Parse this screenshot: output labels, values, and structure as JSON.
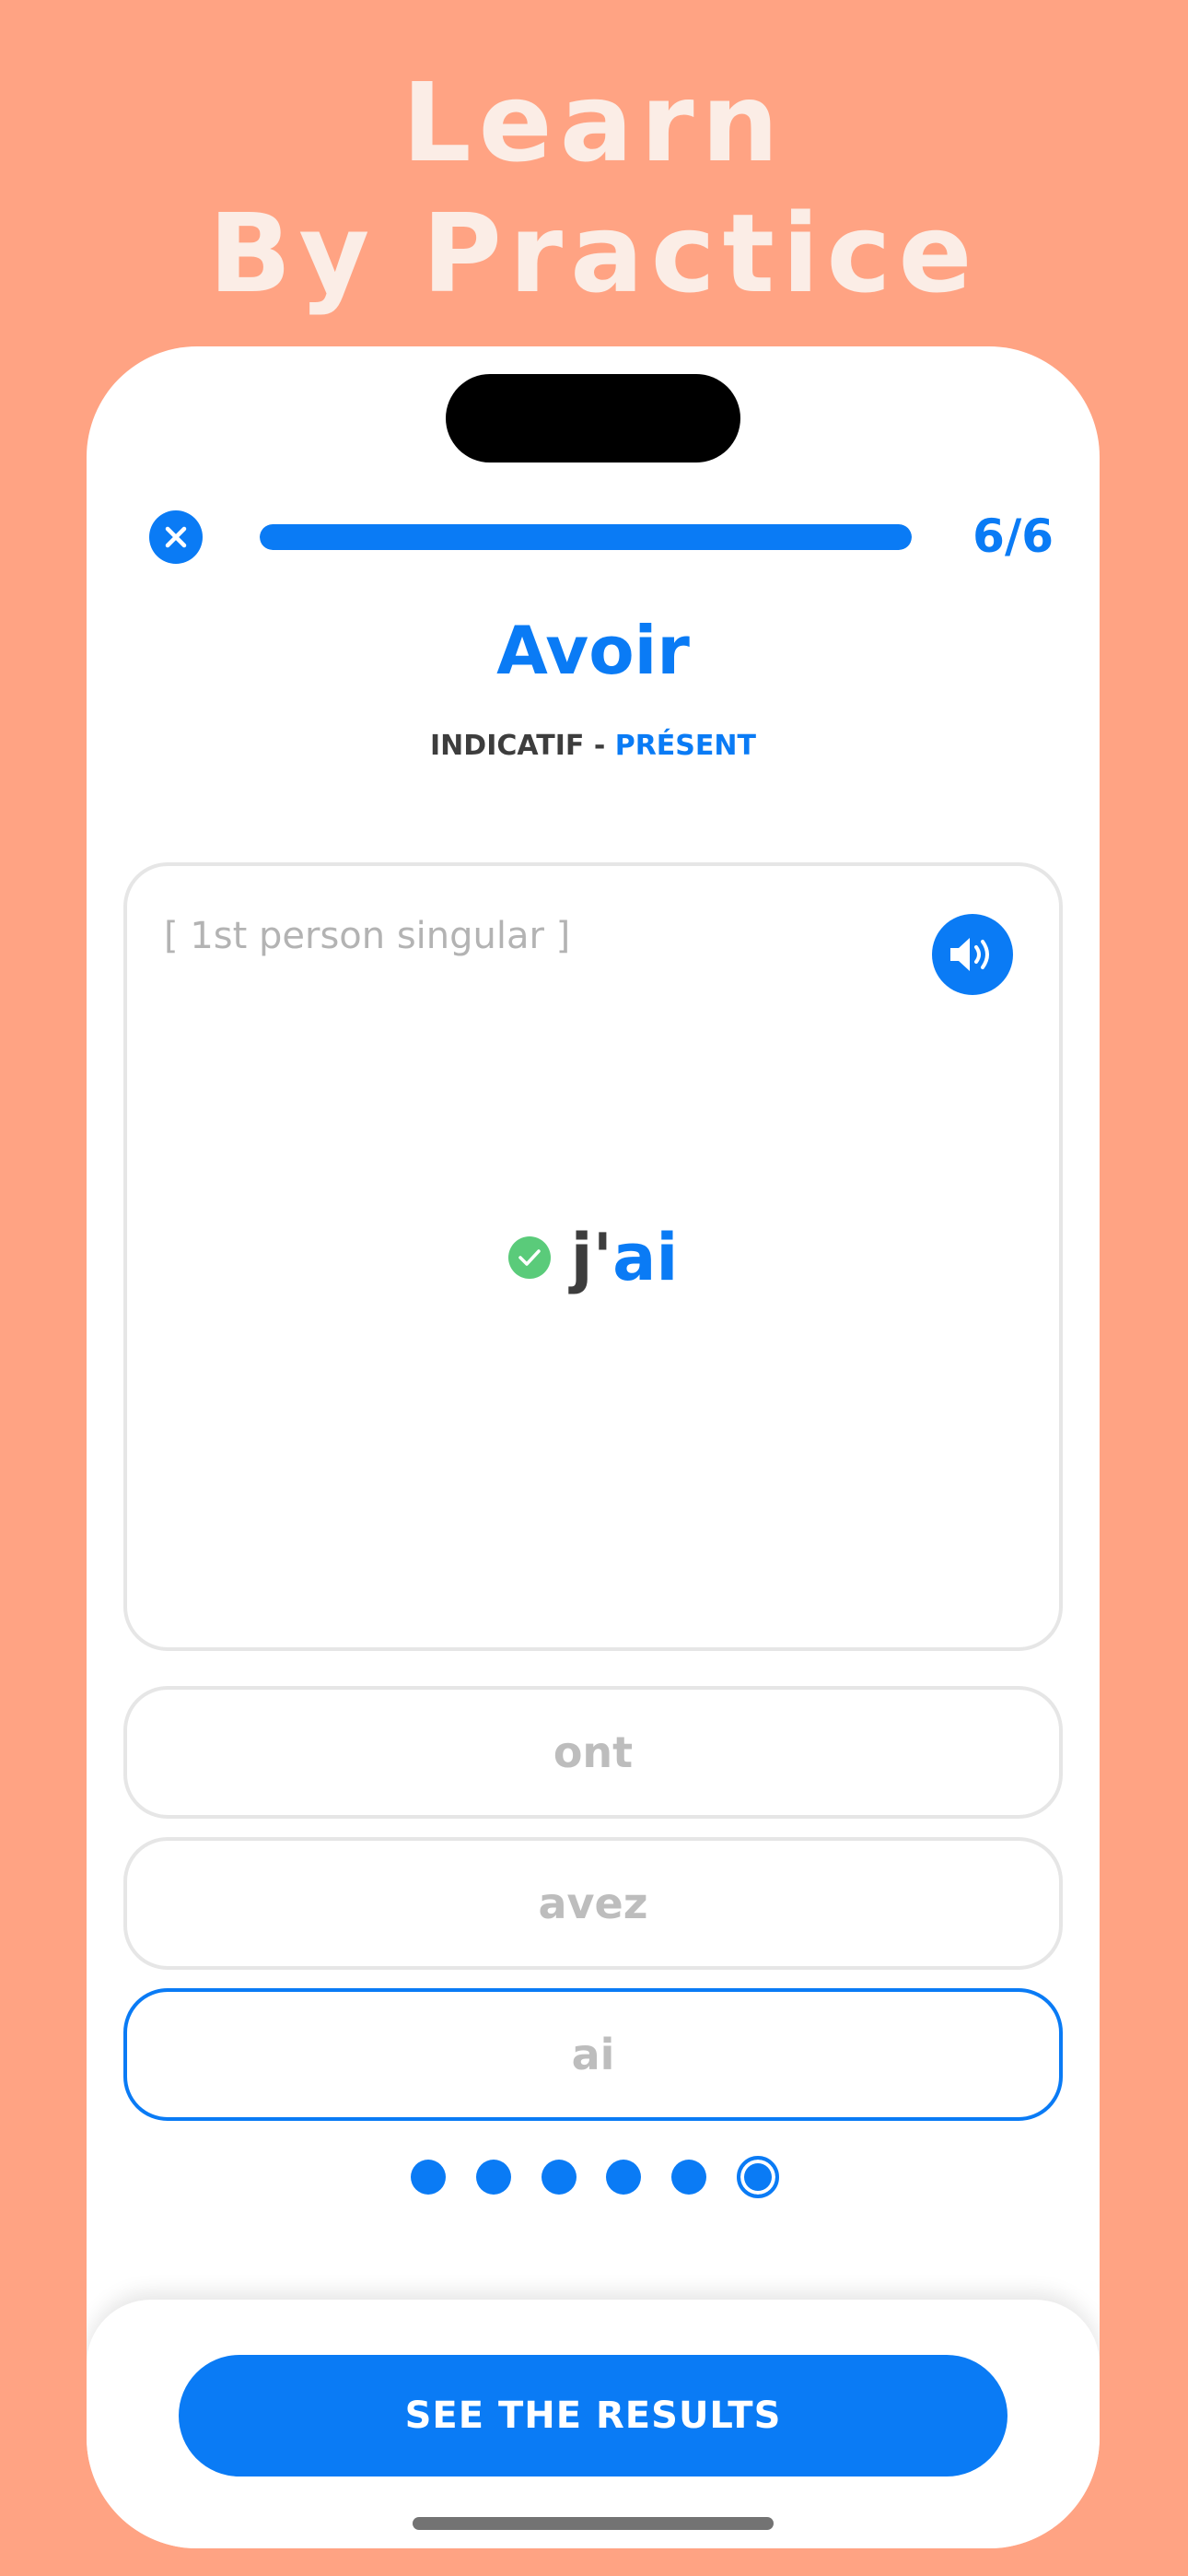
{
  "headline": {
    "line1": "Learn",
    "line2": "By Practice"
  },
  "quiz": {
    "progress_label": "6/6",
    "progress_fraction": 1.0,
    "verb": "Avoir",
    "mood": "INDICATIF - ",
    "tense": "PRÉSENT",
    "person_hint": "[ 1st person singular ]",
    "answer_pronoun": "j'",
    "answer_form": "ai",
    "options": [
      "ont",
      "avez",
      "ai"
    ],
    "selected_option_index": 2,
    "page_dots_total": 6,
    "page_dots_current": 6,
    "results_button": "SEE THE RESULTS"
  },
  "colors": {
    "background": "#FFA383",
    "accent": "#0A7BF5",
    "correct": "#5ACB7A",
    "headline_text": "#FBEDE6"
  },
  "icons": {
    "close": "close-icon",
    "sound": "speaker-icon",
    "correct": "checkmark-circle-icon"
  }
}
